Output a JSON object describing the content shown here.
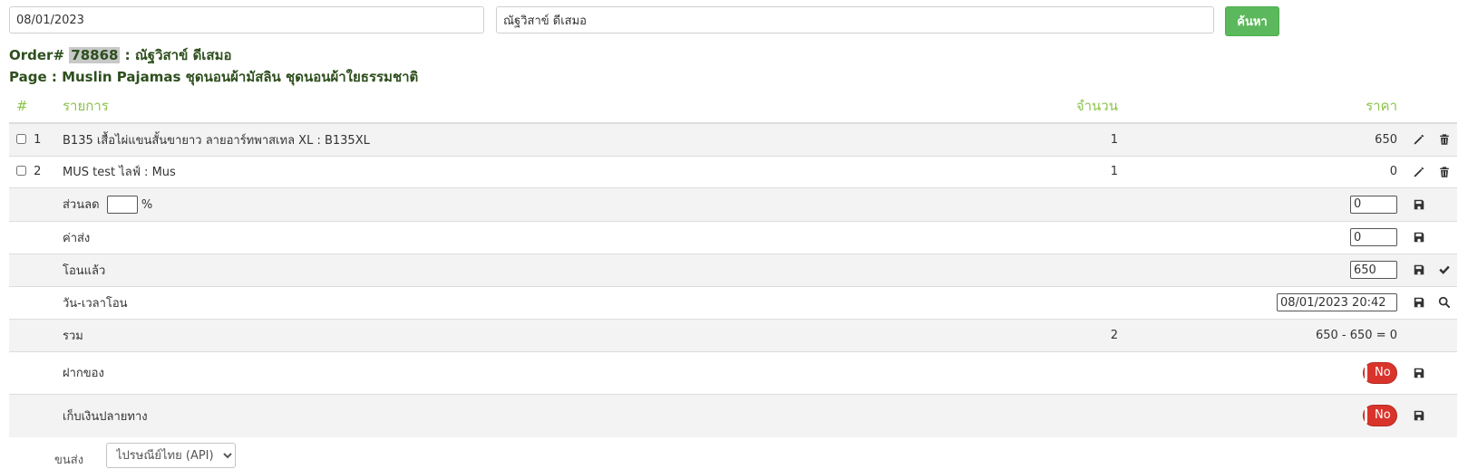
{
  "search": {
    "date_value": "08/01/2023",
    "name_value": "ณัฐวิสาข์ ดีเสมอ",
    "button_label": "ค้นหา"
  },
  "order": {
    "prefix": "Order#",
    "number": "78868",
    "customer": " : ณัฐวิสาข์ ดีเสมอ",
    "page_line": "Page : Muslin Pajamas ชุดนอนผ้ามัสลิน ชุดนอนผ้าใยธรรมชาติ"
  },
  "table": {
    "headers": {
      "num": "#",
      "item": "รายการ",
      "qty": "จำนวน",
      "price": "ราคา"
    },
    "items": [
      {
        "index": "1",
        "name": "B135 เสื้อไผ่แขนสั้นขายาว ลายอาร์ทพาสเทล XL : B135XL",
        "qty": "1",
        "price": "650"
      },
      {
        "index": "2",
        "name": "MUS test ไลฟ์ : Mus",
        "qty": "1",
        "price": "0"
      }
    ],
    "discount": {
      "label": "ส่วนลด",
      "percent_value": "",
      "percent_sign": "%",
      "amount": "0"
    },
    "shipping": {
      "label": "ค่าส่ง",
      "amount": "0"
    },
    "transferred": {
      "label": "โอนแล้ว",
      "amount": "650"
    },
    "transfer_time": {
      "label": "วัน-เวลาโอน",
      "value": "08/01/2023 20:42"
    },
    "total": {
      "label": "รวม",
      "qty": "2",
      "summary": "650 - 650 = 0"
    },
    "deposit": {
      "label": "ฝากของ",
      "toggle": "No"
    },
    "cod": {
      "label": "เก็บเงินปลายทาง",
      "toggle": "No"
    }
  },
  "bottom": {
    "carrier_label": "ขนส่ง",
    "carrier_value": "ไปรษณีย์ไทย (API)"
  },
  "colors": {
    "accent_green": "#5cb85c",
    "header_green": "#8bc34a",
    "title_green": "#2e4f1e",
    "toggle_red": "#d9342b"
  }
}
